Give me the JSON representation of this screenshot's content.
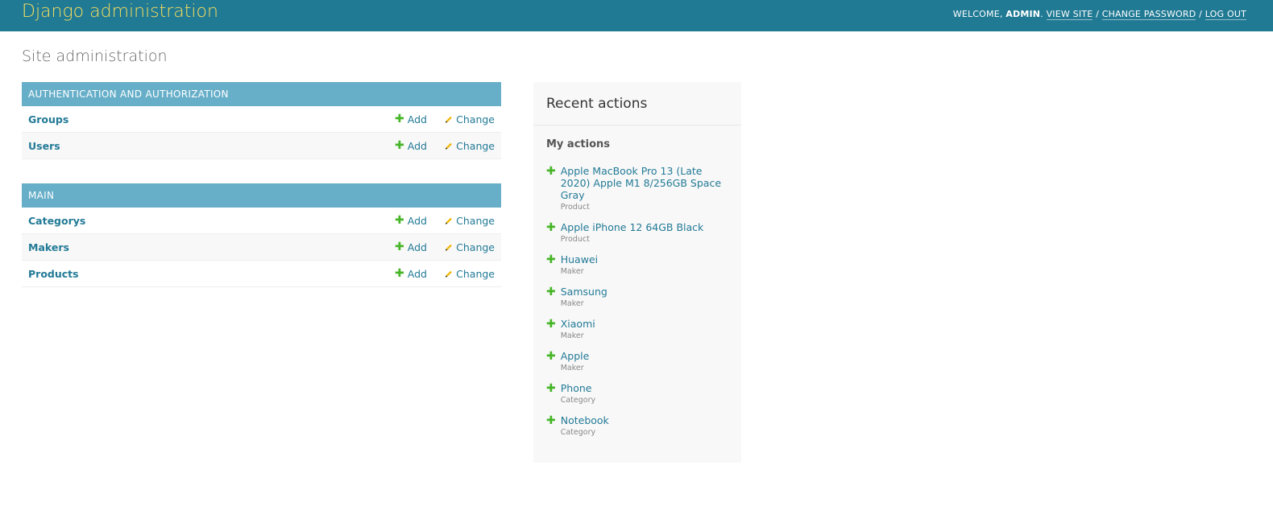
{
  "header": {
    "branding": "Django administration",
    "welcome": "WELCOME, ",
    "username": "ADMIN",
    "sep1": ". ",
    "view_site": "VIEW SITE",
    "sep2": " / ",
    "change_password": "CHANGE PASSWORD",
    "sep3": " / ",
    "log_out": "LOG OUT"
  },
  "page_title": "Site administration",
  "modules": [
    {
      "caption": "AUTHENTICATION AND AUTHORIZATION",
      "rows": [
        {
          "name": "Groups",
          "add": "Add",
          "change": "Change"
        },
        {
          "name": "Users",
          "add": "Add",
          "change": "Change"
        }
      ]
    },
    {
      "caption": "MAIN",
      "rows": [
        {
          "name": "Categorys",
          "add": "Add",
          "change": "Change"
        },
        {
          "name": "Makers",
          "add": "Add",
          "change": "Change"
        },
        {
          "name": "Products",
          "add": "Add",
          "change": "Change"
        }
      ]
    }
  ],
  "recent": {
    "title": "Recent actions",
    "subtitle": "My actions",
    "items": [
      {
        "text": "Apple MacBook Pro 13 (Late 2020) Apple M1 8/256GB Space Gray",
        "type": "Product"
      },
      {
        "text": "Apple iPhone 12 64GB Black",
        "type": "Product"
      },
      {
        "text": "Huawei",
        "type": "Maker"
      },
      {
        "text": "Samsung",
        "type": "Maker"
      },
      {
        "text": "Xiaomi",
        "type": "Maker"
      },
      {
        "text": "Apple",
        "type": "Maker"
      },
      {
        "text": "Phone",
        "type": "Category"
      },
      {
        "text": "Notebook",
        "type": "Category"
      }
    ]
  },
  "icons": {
    "add": "plus-icon",
    "change": "pencil-icon"
  },
  "colors": {
    "header": "#217a94",
    "branding": "#f5dd5d",
    "caption": "#67afc9",
    "link": "#227a96",
    "add_icon": "#46b527",
    "change_icon": "#efb80b"
  }
}
